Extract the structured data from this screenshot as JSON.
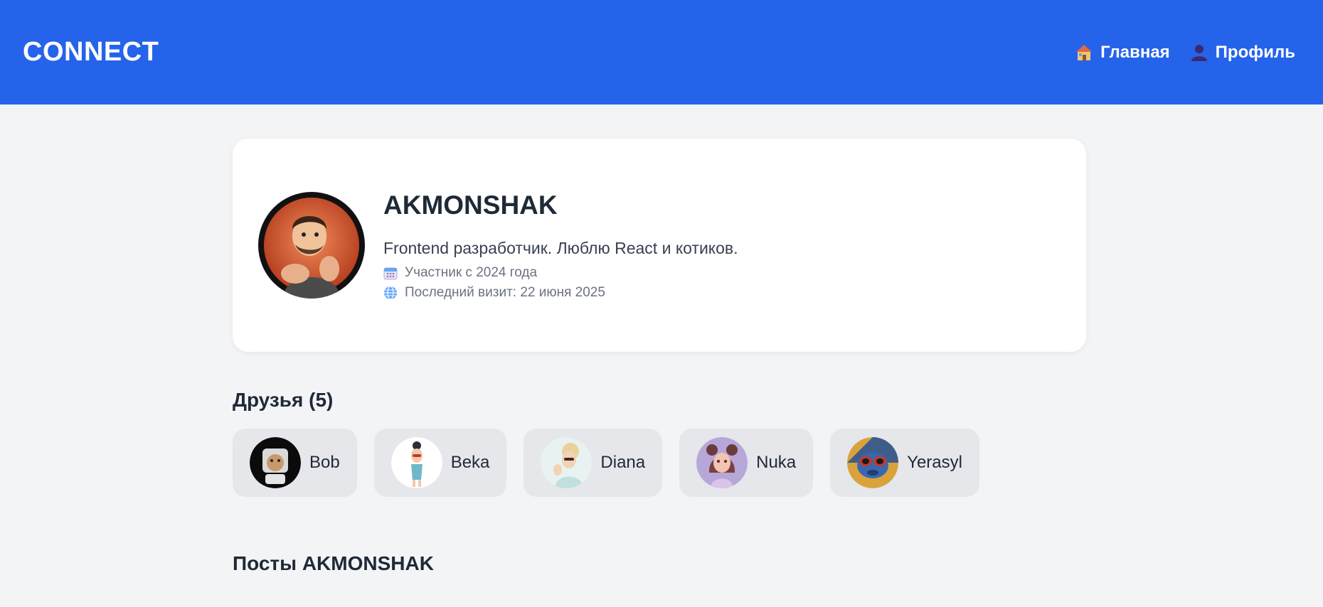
{
  "header": {
    "logo": "CONNECT",
    "nav": [
      {
        "label": "Главная",
        "icon": "house-icon"
      },
      {
        "label": "Профиль",
        "icon": "user-silhouette-icon"
      }
    ]
  },
  "profile": {
    "username": "AKMONSHAK",
    "bio": "Frontend разработчик. Люблю React и котиков.",
    "member_since": "Участник с 2024 года",
    "last_visit": "Последний визит: 22 июня 2025",
    "member_icon": "calendar-icon",
    "visit_icon": "globe-icon"
  },
  "friends": {
    "title": "Друзья (5)",
    "items": [
      {
        "name": "Bob"
      },
      {
        "name": "Beka"
      },
      {
        "name": "Diana"
      },
      {
        "name": "Nuka"
      },
      {
        "name": "Yerasyl"
      }
    ]
  },
  "posts": {
    "title": "Посты AKMONSHAK"
  },
  "colors": {
    "header_bg": "#2563eb",
    "page_bg": "#f3f4f6",
    "card_bg": "#ffffff",
    "chip_bg": "#e5e7eb"
  }
}
